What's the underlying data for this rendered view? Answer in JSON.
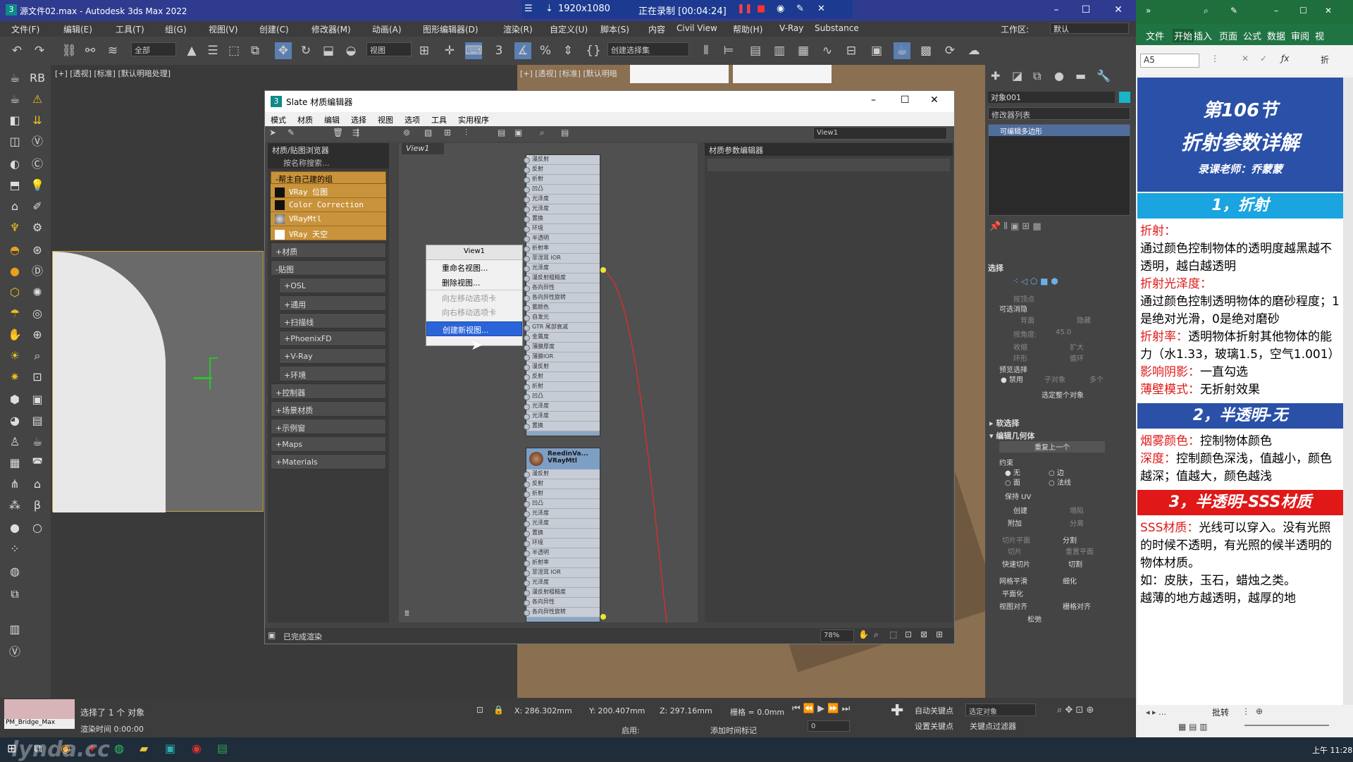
{
  "titlebar": {
    "title": "源文件02.max - Autodesk 3ds Max 2022",
    "app_icon": "3"
  },
  "recorder": {
    "resolution": "1920x1080",
    "status": "正在录制 [00:04:24]"
  },
  "menu": [
    "文件(F)",
    "编辑(E)",
    "工具(T)",
    "组(G)",
    "视图(V)",
    "创建(C)",
    "修改器(M)",
    "动画(A)",
    "图形编辑器(D)",
    "渲染(R)",
    "自定义(U)",
    "脚本(S)",
    "内容",
    "Civil View",
    "帮助(H)",
    "V-Ray",
    "Substance"
  ],
  "workspace": {
    "label": "工作区:",
    "value": "默认"
  },
  "toolbar": {
    "filter": "全部",
    "ref_coord": "视图",
    "selection_set": "创建选择集"
  },
  "viewport": {
    "label": "[+] [透视] [标准] [默认明暗处理]",
    "label2": "[+] [透视] [标准] [默认明暗"
  },
  "slate": {
    "title": "Slate 材质编辑器",
    "menu": [
      "模式",
      "材质",
      "编辑",
      "选择",
      "视图",
      "选项",
      "工具",
      "实用程序"
    ],
    "view_dropdown": "View1",
    "browser_title": "材质/贴图浏览器",
    "search": "按名称搜索...",
    "custom_group": "-帮主自己建的组",
    "custom_items": [
      "VRay 位图",
      "Color Correction",
      "VRayMtl",
      "VRay 天空"
    ],
    "groups": [
      "+材质",
      "-贴图"
    ],
    "map_subgroups": [
      "+OSL",
      "+通用",
      "+扫描线",
      "+PhoenixFD",
      "+V-Ray",
      "+环境"
    ],
    "groups2": [
      "+控制器",
      "+场景材质",
      "+示例窗",
      "+Maps",
      "+Materials"
    ],
    "view_tab": "View1",
    "params_title": "材质参数编辑器",
    "node2_title": "ReedinVa...",
    "node2_sub": "VRayMtl",
    "node_rows": [
      "漫反射",
      "反射",
      "折射",
      "凹凸",
      "光泽度",
      "光泽度",
      "置换",
      "环境",
      "半透明",
      "折射率",
      "菲涅耳 IOR",
      "光泽度",
      "漫反射粗糙度",
      "各向异性",
      "各向异性旋转",
      "雾颜色",
      "自发光",
      "GTR 尾部衰减",
      "金属度",
      "薄膜厚度",
      "薄膜IOR"
    ],
    "status": "已完成渲染",
    "zoom": "78%",
    "context_menu": {
      "header": "View1",
      "items": [
        {
          "label": "重命名视图...",
          "state": "normal"
        },
        {
          "label": "删除视图...",
          "state": "normal"
        },
        {
          "label": "向左移动选项卡",
          "state": "disabled"
        },
        {
          "label": "向右移动选项卡",
          "state": "disabled"
        },
        {
          "label": "创建新视图...",
          "state": "selected"
        }
      ]
    }
  },
  "command_panel": {
    "object": "对象001",
    "object_color": "#1ab4c8",
    "modifier_list": "修改器列表",
    "stack_item": "可编辑多边形",
    "selection": "选择",
    "vertex": "按顶点",
    "removable": "可选消隐",
    "back": "背面",
    "hidden": "隐藏",
    "angle": "按角度:",
    "angle_val": "45.0",
    "shrink": "收缩",
    "grow": "扩大",
    "ring": "环形",
    "loop": "循环",
    "preview": "预览选择",
    "disabled": "禁用",
    "subobj": "子对象",
    "multi": "多个",
    "select_all": "选定整个对象",
    "soft": "软选择",
    "edit_geom": "编辑几何体",
    "repeat": "重复上一个",
    "constraint": "约束",
    "none": "无",
    "edge": "边",
    "face": "面",
    "normal": "法线",
    "preserve_uv": "保持 UV",
    "create": "创建",
    "collapse": "塌陷",
    "attach": "附加",
    "detach": "分离",
    "slice_plane": "切片平面",
    "split": "分割",
    "slice": "切片",
    "reset_plane": "重置平面",
    "quick_slice": "快速切片",
    "cut": "切割",
    "mesh_smooth": "网格平滑",
    "tessellate": "细化",
    "planarize": "平面化",
    "view_align": "视图对齐",
    "grid_align": "栅格对齐",
    "relax": "松弛"
  },
  "bottom": {
    "thumb_label": "PM_Bridge_Max",
    "selected": "选择了 1 个 对象",
    "render_time": "渲染时间  0:00:00",
    "x": "286.302mm",
    "y": "200.407mm",
    "z": "297.16mm",
    "grid": "栅格 = 0.0mm",
    "auto_key": "自动关键点",
    "set_key": "设置关键点",
    "selected_obj": "选定对象",
    "key_filter": "关键点过滤器",
    "enable": "启用:",
    "add_tag": "添加时间标记",
    "frame": "0"
  },
  "excel": {
    "ribbon": [
      "文件",
      "开始",
      "插入",
      "页面",
      "公式",
      "数据",
      "审阅",
      "视"
    ],
    "cell": "A5",
    "banner_line1": "第106节",
    "banner_line2": "折射参数详解",
    "banner_line3": "录课老师：乔蒙蒙",
    "sec1": "1，折射",
    "p1_key": "折射：",
    "p1": "通过颜色控制物体的透明度越黑越不透明，越白越透明",
    "p2_key": "折射光泽度：",
    "p2": "通过颜色控制透明物体的磨砂程度；1是绝对光滑，0是绝对磨砂",
    "p3_key": "折射率：",
    "p3": "透明物体折射其他物体的能力（水1.33，玻璃1.5，空气1.001）",
    "p4_key": "影响阴影：",
    "p4": "一直勾选",
    "p5_key": "薄壁模式：",
    "p5": "无折射效果",
    "sec2": "2，半透明-无",
    "p6_key": "烟雾颜色：",
    "p6": "控制物体颜色",
    "p7_key": "深度：",
    "p7": "控制颜色深浅，值越小，颜色越深；值越大，颜色越浅",
    "sec3": "3，半透明-SSS材质",
    "p8_key": "SSS材质：",
    "p8": "光线可以穿入。没有光照的时候不透明，有光照的候半透明的物体材质。",
    "p9": "如：皮肤，玉石，蜡烛之类。",
    "p10": "越薄的地方越透明，越厚的地",
    "status": "批转",
    "time": "上午 11:28"
  },
  "watermark": "lynda.cc"
}
